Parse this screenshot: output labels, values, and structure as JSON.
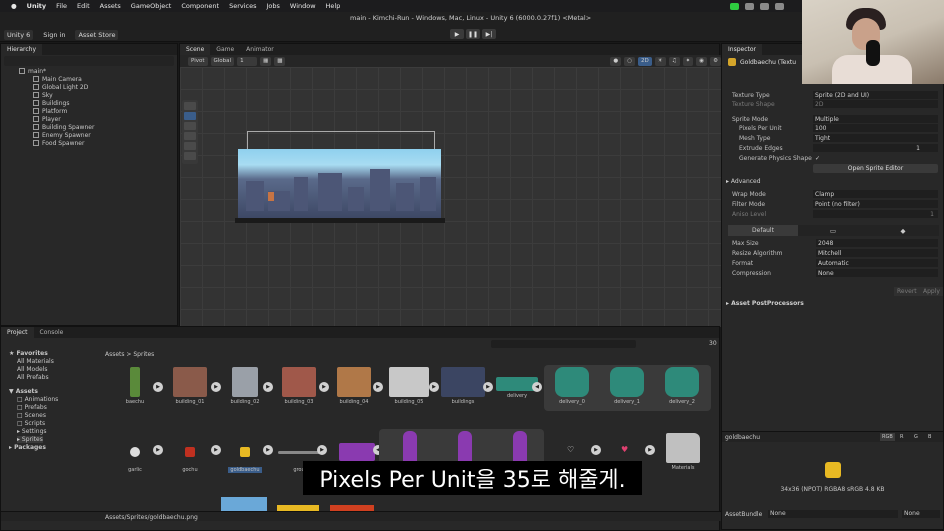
{
  "menubar": {
    "items": [
      "Unity",
      "File",
      "Edit",
      "Assets",
      "GameObject",
      "Component",
      "Services",
      "Jobs",
      "Window",
      "Help"
    ]
  },
  "window": {
    "title": "main - Kimchi-Run - Windows, Mac, Linux - Unity 6 (6000.0.27f1) <Metal>"
  },
  "toolbar": {
    "unity_label": "Unity 6",
    "sign_in": "Sign in",
    "asset_store": "Asset Store"
  },
  "hierarchy": {
    "tab": "Hierarchy",
    "scene": "main*",
    "items": [
      "Main Camera",
      "Global Light 2D",
      "Sky",
      "Buildings",
      "Platform",
      "Player",
      "Building Spawner",
      "Enemy Spawner",
      "Food Spawner"
    ]
  },
  "scene": {
    "tabs": [
      "Scene",
      "Game",
      "Animator"
    ],
    "pivot": "Pivot",
    "global": "Global",
    "grid_num": "1",
    "mode_2d": "2D"
  },
  "inspector": {
    "tab": "Inspector",
    "asset_name": "Goldbaechu (Textu",
    "rows": [
      {
        "label": "Texture Type",
        "value": "Sprite (2D and UI)"
      },
      {
        "label": "Texture Shape",
        "value": "2D"
      },
      {
        "label": "Sprite Mode",
        "value": "Multiple"
      },
      {
        "label": "Pixels Per Unit",
        "value": "100"
      },
      {
        "label": "Mesh Type",
        "value": "Tight"
      },
      {
        "label": "Extrude Edges",
        "value": "1"
      },
      {
        "label": "Generate Physics Shape",
        "value": "✓"
      }
    ],
    "open_editor": "Open Sprite Editor",
    "advanced": "Advanced",
    "wrap_label": "Wrap Mode",
    "wrap_value": "Clamp",
    "filter_label": "Filter Mode",
    "filter_value": "Point (no filter)",
    "aniso_label": "Aniso Level",
    "aniso_value": "1",
    "platform_default": "Default",
    "max_size_label": "Max Size",
    "max_size_value": "2048",
    "resize_label": "Resize Algorithm",
    "resize_value": "Mitchell",
    "format_label": "Format",
    "format_value": "Automatic",
    "compression_label": "Compression",
    "compression_value": "None",
    "revert": "Revert",
    "apply": "Apply",
    "postprocessors": "Asset PostProcessors",
    "preview_name": "goldbaechu",
    "rgb": "RGB",
    "r": "R",
    "g": "G",
    "b": "B",
    "preview_info": "34x36 (NPOT)  RGBA8 sRGB  4.8 KB",
    "bundle_label": "AssetBundle",
    "bundle_value": "None",
    "bundle_variant": "None"
  },
  "project": {
    "tabs": [
      "Project",
      "Console"
    ],
    "favorites": "Favorites",
    "fav_items": [
      "All Materials",
      "All Models",
      "All Prefabs"
    ],
    "assets": "Assets",
    "folders": [
      "Animations",
      "Prefabs",
      "Scenes",
      "Scripts",
      "Settings",
      "Sprites"
    ],
    "packages": "Packages",
    "breadcrumb": "Assets > Sprites",
    "count": "30",
    "row1": [
      "baechu",
      "building_01",
      "building_02",
      "building_03",
      "building_04",
      "building_05",
      "buildings",
      "delivery",
      "delivery_0",
      "delivery_1",
      "delivery_2"
    ],
    "row2": [
      "garlic",
      "gochu",
      "goldbaechu",
      "grou",
      "Materials"
    ],
    "status_path": "Assets/Sprites/goldbaechu.png"
  },
  "subtitle": "Pixels Per Unit을 35로 해줄게."
}
